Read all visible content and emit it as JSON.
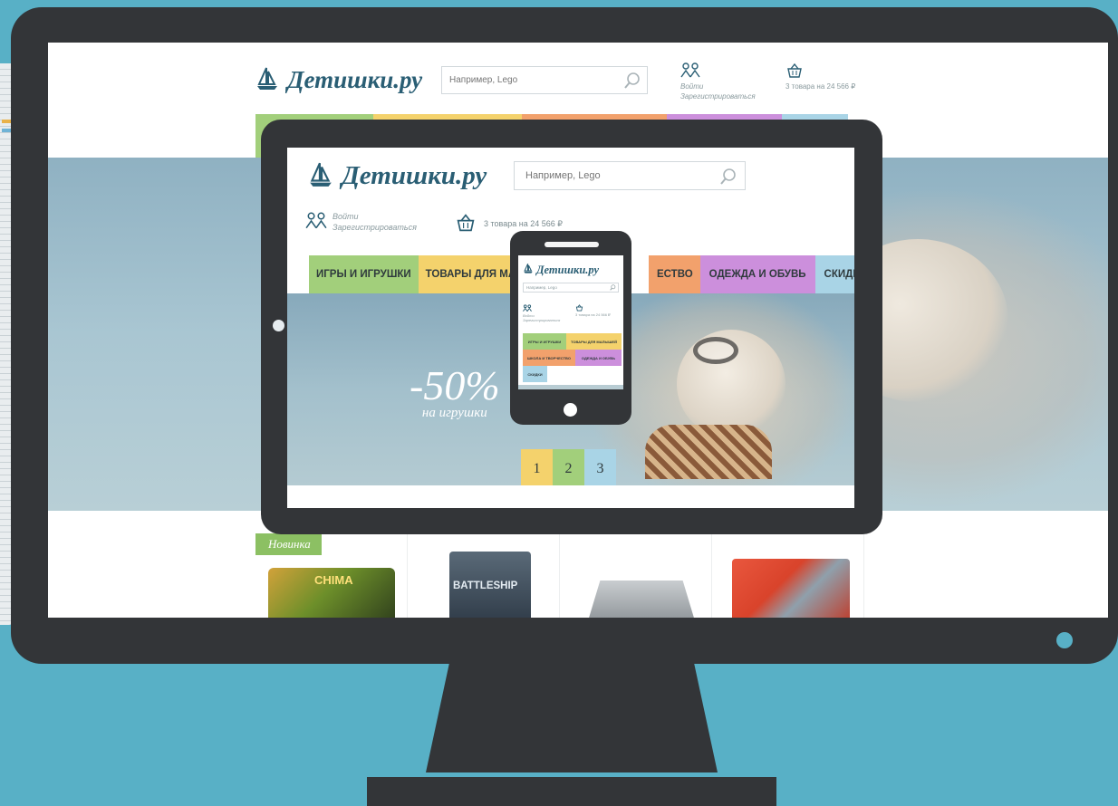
{
  "colors": {
    "background": "#58b0c6",
    "frame": "#333538",
    "logo_text": "#2a5e74",
    "tab_green": "#a2cf7b",
    "tab_yellow": "#f4d26c",
    "tab_orange": "#f2a16c",
    "tab_purple": "#cc8fdc",
    "tab_blue": "#a9d4e6",
    "novinka": "#8cc063"
  },
  "site": {
    "logo_text": "Детишки.ру",
    "search_placeholder": "Например, Lego",
    "login_label": "Войти",
    "register_label": "Зарегистрироваться",
    "cart_text": "3 товара на 24 566 ₽",
    "nav": {
      "games": "ИГРЫ И ИГРУШКИ",
      "baby_goods_cut": "ТОВАРЫ ДЛЯ МАЛЬ",
      "creativity_cut": "ЕСТВО",
      "clothing": "ОДЕЖДА И ОБУВЬ",
      "discounts": "СКИДКИ"
    },
    "hero": {
      "sale_percent": "-50%",
      "sale_caption": "на игрушки"
    },
    "pager": [
      "1",
      "2",
      "3"
    ],
    "badge_new": "Новинка",
    "products": [
      {
        "brand_text": "CHIMA",
        "icon": "lego-chima-box"
      },
      {
        "brand_text": "BATTLESHIP",
        "icon": "battleship-game-box"
      },
      {
        "icon": "building-model"
      },
      {
        "icon": "planes-toy-box"
      }
    ]
  },
  "phone_menu": {
    "games": "ИГРЫ И ИГРУШКИ",
    "baby_goods": "ТОВАРЫ ДЛЯ МАЛЫШЕЙ",
    "creativity": "ШКОЛА И ТВОРЧЕСТВО",
    "clothing": "ОДЕЖДА И ОБУВЬ",
    "discounts": "СКИДКИ"
  },
  "phone_cart_text": "3 товара на 24 566 ₽"
}
